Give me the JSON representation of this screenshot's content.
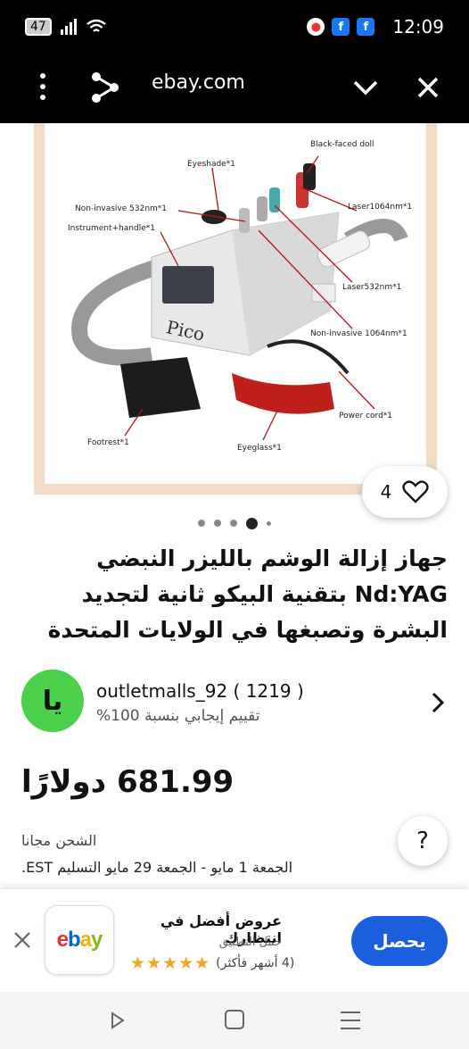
{
  "status_bar": {
    "battery": "47",
    "time": "12:09"
  },
  "browser": {
    "url": "ebay.com"
  },
  "product_image": {
    "labels": {
      "black_faced_doll": "Black-faced doll",
      "eyeshade": "Eyeshade*1",
      "non_invasive_532": "Non-invasive 532nm*1",
      "laser_1064": "Laser1064nm*1",
      "instrument_handle": "Instrument+handle*1",
      "laser_532": "Laser532nm*1",
      "non_invasive_1064": "Non-invasive 1064nm*1",
      "power_cord": "Power cord*1",
      "footrest": "Footrest*1",
      "eyeglass": "Eyeglass*1",
      "brand": "Pico"
    }
  },
  "gallery": {
    "like_count": "4",
    "active_dot": 3
  },
  "product": {
    "title": "جهاز إزالة الوشم بالليزر النبضي Nd:YAG بتقنية البيكو ثانية لتجديد البشرة وتصبغها في الولايات المتحدة"
  },
  "seller": {
    "avatar_text": "يا",
    "name": "outletmalls_92 ( 1219 )",
    "rating": "تقييم إيجابي بنسبة 100%"
  },
  "pricing": {
    "price": "681.99 دولارًا",
    "shipping": "الشحن مجانا",
    "delivery_label": "الجمعة 1 مايو - الجمعة 29 مايو التسليم EST."
  },
  "help": {
    "label": "?"
  },
  "app_banner": {
    "title": "عروض أفضل في انتظارك",
    "subtitle": "حمل التطبيق",
    "stars": "★★★★★",
    "reviews": "(4 أشهر فأكثر)",
    "button_label": "يحصل",
    "logo": {
      "e": "e",
      "b": "b",
      "a": "a",
      "y": "y"
    }
  },
  "colors": {
    "accent_blue": "#1b5fde",
    "avatar_green": "#4bd14b",
    "star_gold": "#f5a623",
    "image_border": "#f1dcc6"
  }
}
